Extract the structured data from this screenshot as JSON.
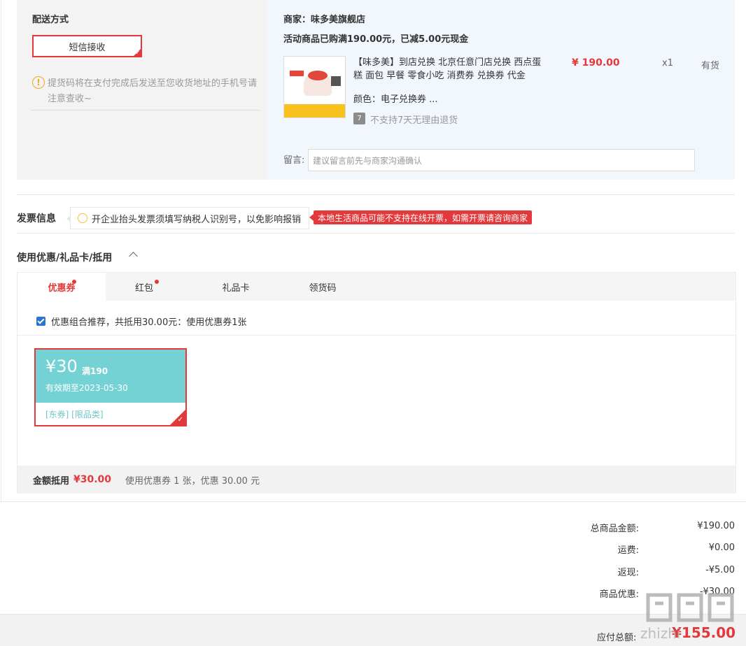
{
  "delivery": {
    "title": "配送方式",
    "method": "短信接收",
    "note": "提货码将在支付完成后发送至您收货地址的手机号请注意查收~"
  },
  "merchant": {
    "label": "商家：味多美旗舰店",
    "promo": "活动商品已购满190.00元，已减5.00元现金"
  },
  "product": {
    "name": "【味多美】到店兑换 北京任意门店兑换 西点蛋糕 面包 早餐 零食小吃 消费券 兑换券 代金",
    "price": "¥ 190.00",
    "qty": "x1",
    "stock": "有货",
    "color": "颜色：电子兑换券 ...",
    "no_return_icon": "7",
    "no_return": "不支持7天无理由退货",
    "message_label": "留言:",
    "message_placeholder": "建议留言前先与商家沟通确认"
  },
  "invoice": {
    "title": "发票信息",
    "tip": "开企业抬头发票须填写纳税人识别号，以免影响报销",
    "warning": "本地生活商品可能不支持在线开票，如需开票请咨询商家"
  },
  "coupons": {
    "title": "使用优惠/礼品卡/抵用",
    "tabs": [
      {
        "label": "优惠券"
      },
      {
        "label": "红包"
      },
      {
        "label": "礼品卡"
      },
      {
        "label": "领货码"
      }
    ],
    "combo_text": "优惠组合推荐，共抵用30.00元：使用优惠券1张",
    "card": {
      "amount": "¥30",
      "condition": "满190",
      "valid": "有效期至2023-05-30",
      "tags": "[东券] [限品类]"
    },
    "footer_label": "金额抵用",
    "footer_amount": "¥30.00",
    "footer_desc": "使用优惠券 1 张，优惠 30.00 元"
  },
  "summary": {
    "rows": [
      {
        "label": "总商品金额:",
        "value": "¥190.00"
      },
      {
        "label": "运费:",
        "value": "¥0.00"
      },
      {
        "label": "返现:",
        "value": "-¥5.00"
      },
      {
        "label": "商品优惠:",
        "value": "-¥30.00"
      }
    ],
    "total_label": "应付总额:",
    "total_value": "¥155.00"
  },
  "watermark": {
    "text": "zhizhi"
  },
  "colors": {
    "accent": "#e4393c",
    "coupon": "#74d2d4",
    "checkbox": "#2b74d4"
  }
}
